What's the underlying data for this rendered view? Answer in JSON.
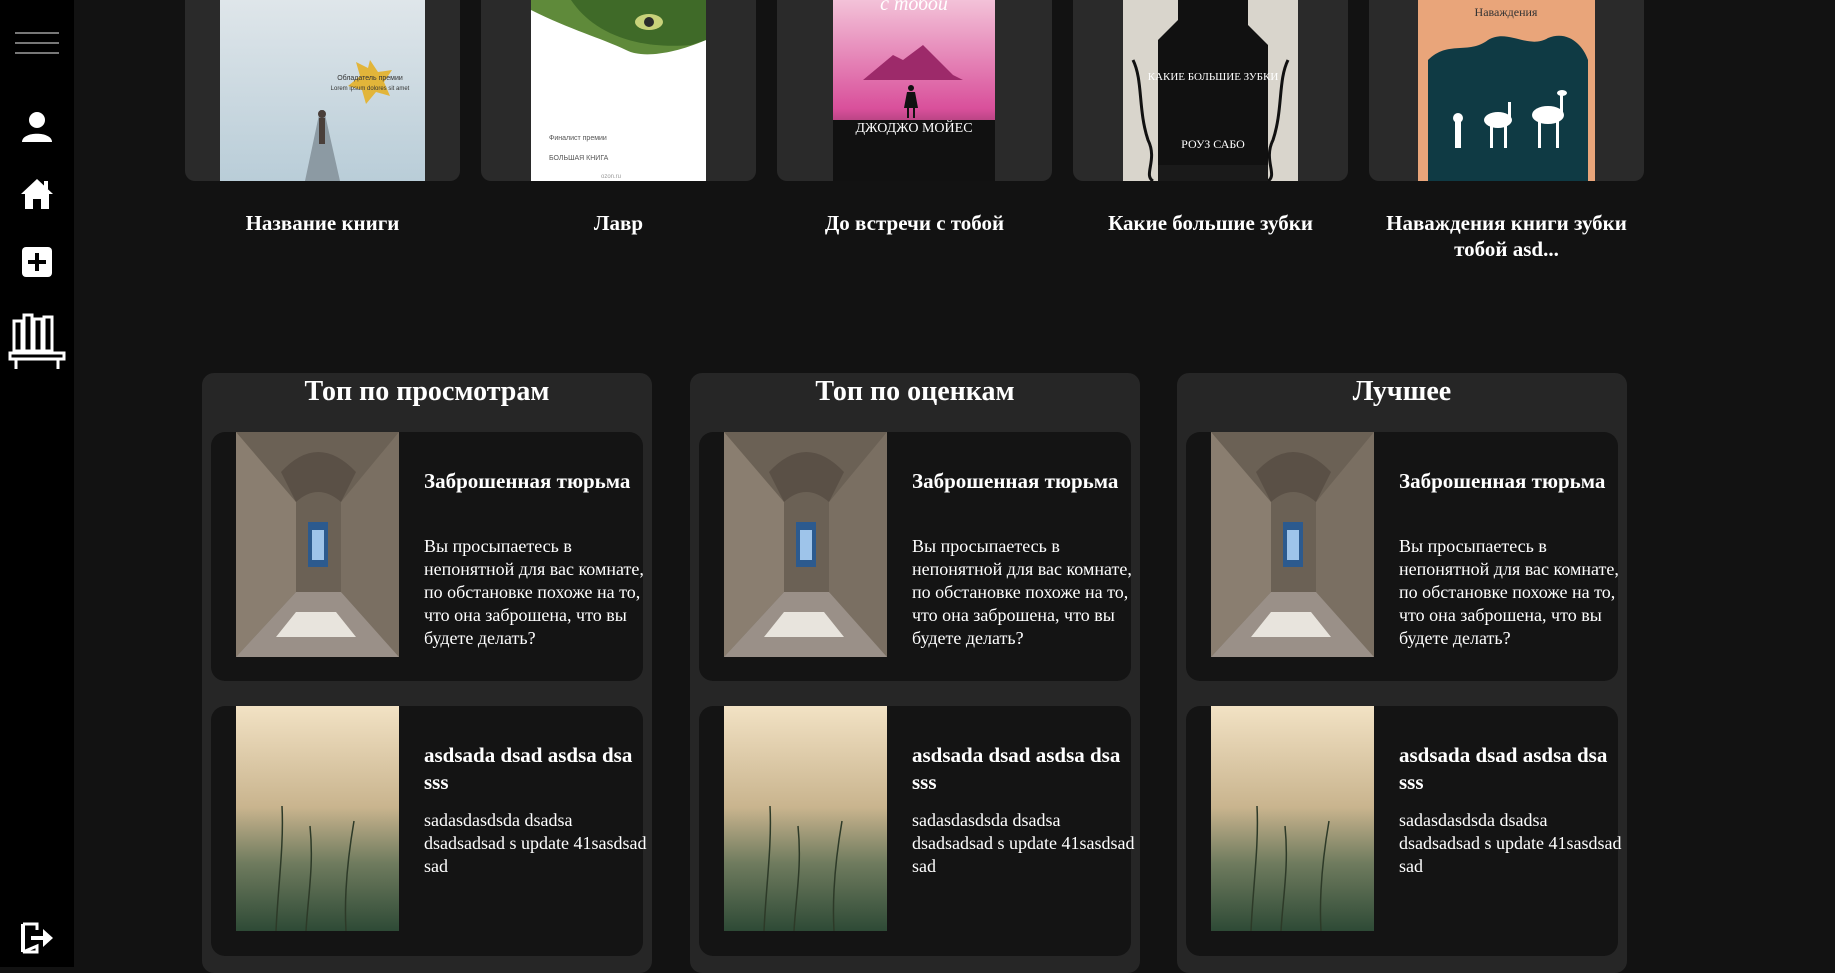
{
  "sidebar": {
    "items": [
      {
        "name": "menu-icon"
      },
      {
        "name": "user-icon"
      },
      {
        "name": "home-icon"
      },
      {
        "name": "add-icon"
      },
      {
        "name": "library-icon"
      },
      {
        "name": "logout-icon"
      }
    ]
  },
  "books": [
    {
      "title": "Название книги",
      "cover_text": [
        "Обладатель премии",
        "Lorem ipsum dolores sit amet"
      ]
    },
    {
      "title": "Лавр",
      "cover_text": [
        "Финалист премии",
        "БОЛЬШАЯ КНИГА",
        "ozon.ru"
      ]
    },
    {
      "title": "До встречи с тобой",
      "cover_text": [
        "с тобой",
        "ДЖОДЖО МОЙЕС"
      ]
    },
    {
      "title": "Какие большие зубки",
      "cover_text": [
        "КАКИЕ БОЛЬШИЕ ЗУБКИ",
        "РОУЗ САБО"
      ]
    },
    {
      "title": "Наваждения книги зубки тобой asd...",
      "cover_text": [
        "Наваждения"
      ]
    }
  ],
  "lists": [
    {
      "heading": "Топ по просмотрам"
    },
    {
      "heading": "Топ по оценкам"
    },
    {
      "heading": "Лучшее"
    }
  ],
  "items": [
    {
      "title": "Заброшенная тюрьма",
      "description": "Вы просыпаетесь в непонятной для вас комнате, по обстановке похоже на то, что она заброшена, что вы будете делать?"
    },
    {
      "title": "asdsada dsad asdsa dsa sss",
      "description": "sadasdasdsda dsadsa dsadsadsad s update 41sasdsad sad"
    }
  ]
}
